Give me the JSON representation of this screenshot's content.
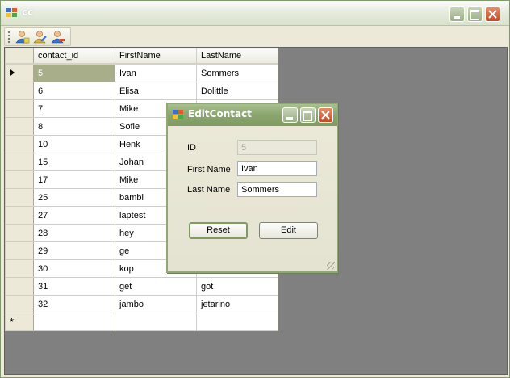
{
  "window": {
    "title": "cc"
  },
  "toolbar": {
    "buttons": [
      "users-icon",
      "users-edit-icon",
      "users-remove-icon"
    ]
  },
  "grid": {
    "columns": [
      "contact_id",
      "FirstName",
      "LastName"
    ],
    "rows": [
      [
        "5",
        "Ivan",
        "Sommers"
      ],
      [
        "6",
        "Elisa",
        "Dolittle"
      ],
      [
        "7",
        "Mike",
        ""
      ],
      [
        "8",
        "Sofie",
        ""
      ],
      [
        "10",
        "Henk",
        ""
      ],
      [
        "15",
        "Johan",
        ""
      ],
      [
        "17",
        "Mike",
        ""
      ],
      [
        "25",
        "bambi",
        ""
      ],
      [
        "27",
        "laptest",
        ""
      ],
      [
        "28",
        "hey",
        ""
      ],
      [
        "29",
        "ge",
        ""
      ],
      [
        "30",
        "kop",
        ""
      ],
      [
        "31",
        "get",
        "got"
      ],
      [
        "32",
        "jambo",
        "jetarino"
      ]
    ],
    "selected_row": 0,
    "new_row_marker": "*"
  },
  "dialog": {
    "title": "EditContact",
    "fields": {
      "id_label": "ID",
      "id_value": "5",
      "first_label": "First Name",
      "first_value": "Ivan",
      "last_label": "Last Name",
      "last_value": "Sommers"
    },
    "reset_label": "Reset",
    "edit_label": "Edit"
  },
  "colors": {
    "titlebar_accent": "#8aa56e",
    "selected_cell": "#a8ad8a",
    "grid_background": "#808080",
    "close_button": "#c74a24"
  }
}
